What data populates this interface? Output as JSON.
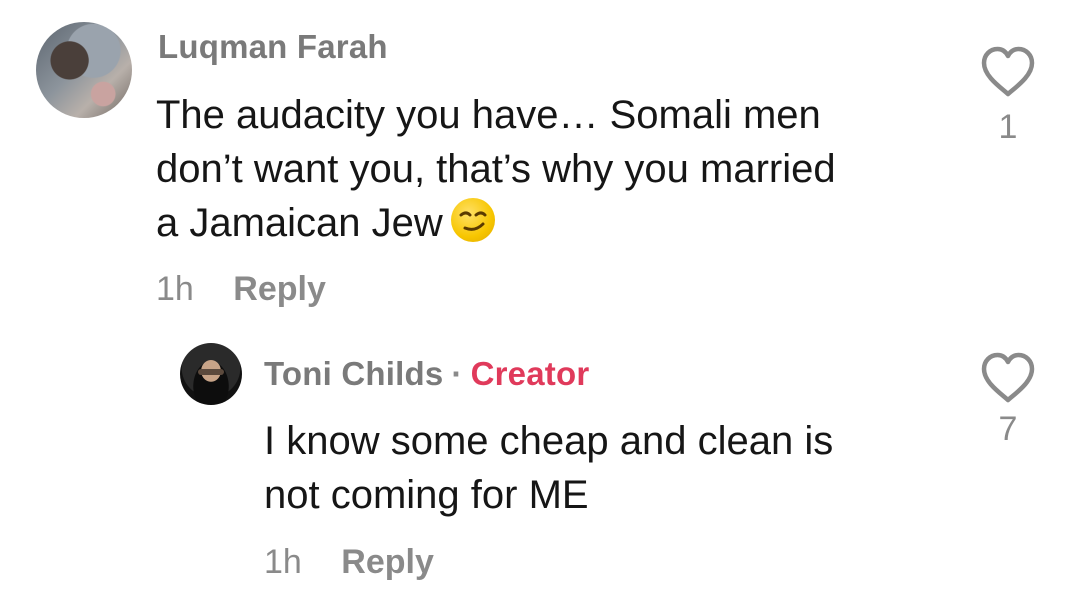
{
  "comments": [
    {
      "username": "Luqman Farah",
      "text_line1": "The audacity you have… Somali men",
      "text_line2": "don’t want you, that’s why you married",
      "text_line3": "a Jamaican Jew",
      "emoji": "smirking-face",
      "time": "1h",
      "reply_label": "Reply",
      "like_count": "1"
    },
    {
      "username": "Toni Childs",
      "separator": "·",
      "badge": "Creator",
      "text_line1": "I know some cheap and clean is",
      "text_line2": "not coming for ME",
      "time": "1h",
      "reply_label": "Reply",
      "like_count": "7"
    }
  ],
  "icons": {
    "like": "heart-outline-icon"
  },
  "colors": {
    "creator_badge": "#e03a5b",
    "secondary_text": "#8a8a8a",
    "primary_text": "#161616"
  }
}
